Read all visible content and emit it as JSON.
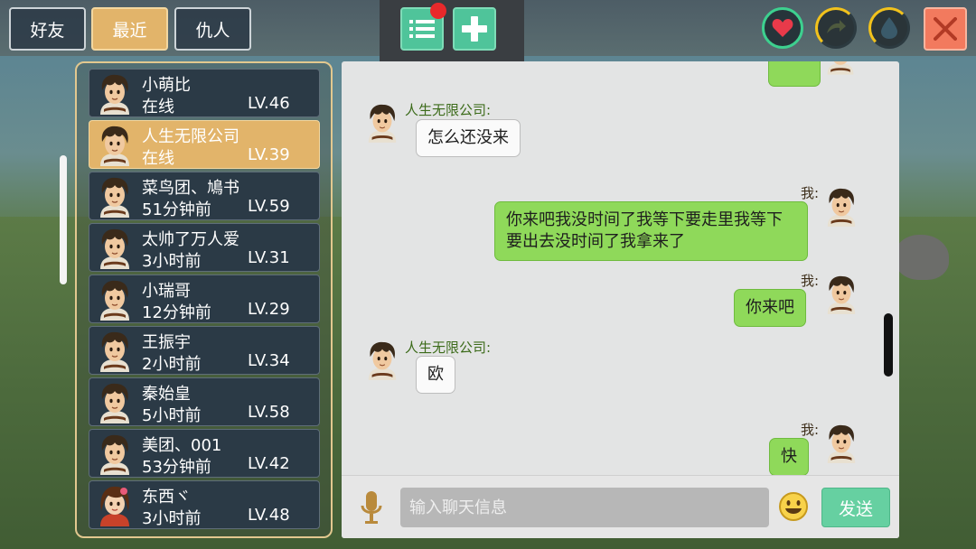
{
  "tabs": {
    "friends": "好友",
    "recent": "最近",
    "enemies": "仇人"
  },
  "icons": {
    "list": "list-icon",
    "add": "plus-icon",
    "heart": "heart-icon",
    "stamina": "stamina-icon",
    "water": "water-drop-icon",
    "close": "close-icon",
    "mic": "microphone-icon",
    "emoji": "emoji-icon"
  },
  "colors": {
    "accent_green": "#4fc49a",
    "tab_active": "#e2b46a",
    "close_red": "#f27a5e",
    "bubble_mine": "#8fd95a"
  },
  "friends": [
    {
      "name": "小萌比",
      "status": "在线",
      "level": "LV.46"
    },
    {
      "name": "人生无限公司",
      "status": "在线",
      "level": "LV.39"
    },
    {
      "name": "菜鸟团、鳩书",
      "status": "51分钟前",
      "level": "LV.59"
    },
    {
      "name": "太帅了万人爱",
      "status": "3小时前",
      "level": "LV.31"
    },
    {
      "name": "小瑞哥",
      "status": "12分钟前",
      "level": "LV.29"
    },
    {
      "name": "王振宇",
      "status": "2小时前",
      "level": "LV.34"
    },
    {
      "name": "秦始皇",
      "status": "5小时前",
      "level": "LV.58"
    },
    {
      "name": "美团、001",
      "status": "53分钟前",
      "level": "LV.42"
    },
    {
      "name": "东西ヾ",
      "status": "3小时前",
      "level": "LV.48"
    }
  ],
  "messages": [
    {
      "sender": "人生无限公司:",
      "text": "怎么还没来"
    },
    {
      "sender": "我:",
      "text": "你来吧我没时间了我等下要走里我等下要出去没时间了我拿来了"
    },
    {
      "sender": "我:",
      "text": "你来吧"
    },
    {
      "sender": "人生无限公司:",
      "text": "欧"
    },
    {
      "sender": "我:",
      "text": "快"
    }
  ],
  "input": {
    "placeholder": "输入聊天信息",
    "send_label": "发送"
  }
}
